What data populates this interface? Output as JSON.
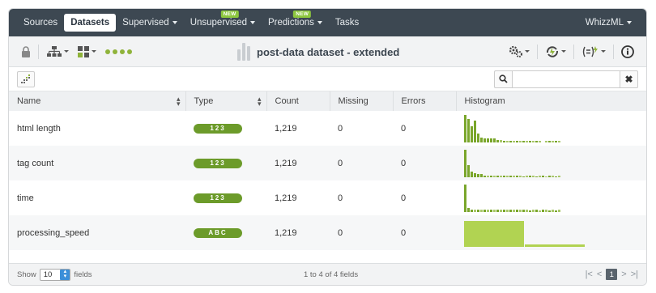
{
  "nav": {
    "items": [
      {
        "label": "Sources",
        "active": false,
        "caret": false,
        "badge": ""
      },
      {
        "label": "Datasets",
        "active": true,
        "caret": false,
        "badge": ""
      },
      {
        "label": "Supervised",
        "active": false,
        "caret": true,
        "badge": ""
      },
      {
        "label": "Unsupervised",
        "active": false,
        "caret": true,
        "badge": "NEW"
      },
      {
        "label": "Predictions",
        "active": false,
        "caret": true,
        "badge": "NEW"
      },
      {
        "label": "Tasks",
        "active": false,
        "caret": false,
        "badge": ""
      }
    ],
    "user": "WhizzML"
  },
  "toolbar": {
    "title": "post-data dataset - extended"
  },
  "search": {
    "placeholder": "",
    "value": ""
  },
  "table": {
    "headers": [
      "Name",
      "Type",
      "Count",
      "Missing",
      "Errors",
      "Histogram"
    ],
    "rows": [
      {
        "name": "html length",
        "type": "123",
        "count": "1,219",
        "missing": "0",
        "errors": "0",
        "histogram": [
          30,
          26,
          18,
          24,
          10,
          5,
          4,
          4,
          4,
          4,
          3,
          3,
          2,
          2,
          2,
          2,
          2,
          2,
          2,
          2,
          2,
          2,
          2,
          2,
          0,
          2,
          2,
          2,
          2,
          2
        ]
      },
      {
        "name": "tag count",
        "type": "123",
        "count": "1,219",
        "missing": "0",
        "errors": "0",
        "histogram": [
          28,
          12,
          6,
          4,
          3,
          3,
          2,
          2,
          2,
          2,
          2,
          2,
          2,
          2,
          2,
          2,
          2,
          2,
          1,
          2,
          2,
          2,
          1,
          2,
          2,
          1,
          2,
          2,
          1,
          2
        ]
      },
      {
        "name": "time",
        "type": "123",
        "count": "1,219",
        "missing": "0",
        "errors": "0",
        "histogram": [
          30,
          4,
          3,
          3,
          3,
          3,
          3,
          3,
          3,
          3,
          3,
          3,
          3,
          3,
          3,
          3,
          3,
          3,
          3,
          3,
          2,
          3,
          3,
          2,
          3,
          3,
          2,
          3,
          2,
          3
        ]
      },
      {
        "name": "processing_speed",
        "type": "ABC",
        "count": "1,219",
        "missing": "0",
        "errors": "0",
        "histogram_categorical": [
          {
            "value": 92,
            "width": 74
          },
          {
            "value": 10,
            "width": 74
          }
        ]
      }
    ]
  },
  "footer": {
    "show_label": "Show",
    "page_size": "10",
    "fields_label": "fields",
    "range_text": "1 to 4 of 4 fields",
    "current_page": "1"
  },
  "colors": {
    "nav_bg": "#3d4852",
    "numeric_pill": "#6c9b2a",
    "categorical_bar": "#b1d352",
    "histogram_bar": "#7aa62b"
  }
}
